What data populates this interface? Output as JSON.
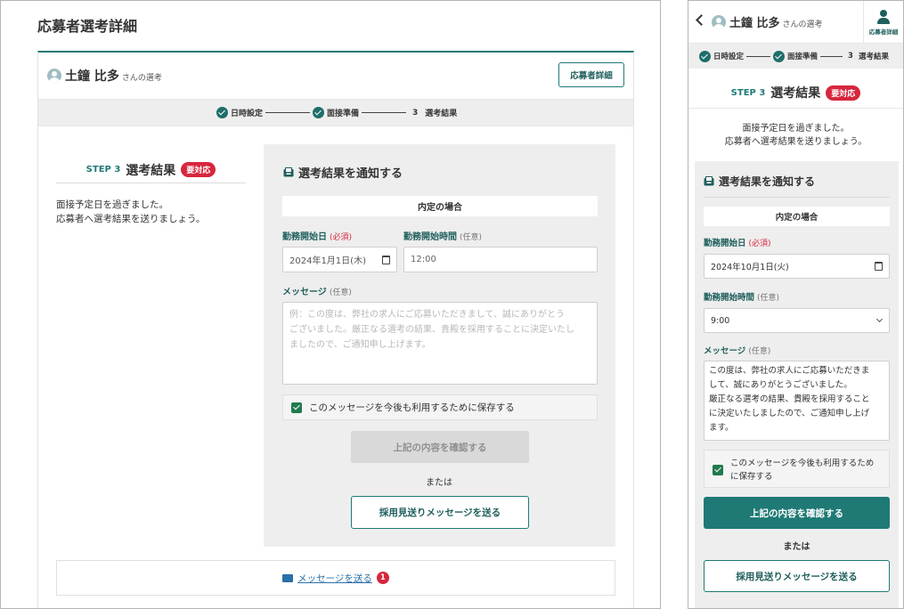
{
  "page_title": "応募者選考詳細",
  "applicant": {
    "name": "土鐘 比多",
    "suffix": "さんの選考"
  },
  "detail_button": "応募者詳細",
  "steps": [
    {
      "label": "日時設定",
      "state": "done"
    },
    {
      "label": "面接準備",
      "state": "done"
    },
    {
      "num": "3",
      "label": "選考結果",
      "state": "current"
    }
  ],
  "step_heading": {
    "step_label": "STEP 3",
    "title": "選考結果",
    "badge": "要対応"
  },
  "hint": {
    "line1": "面接予定日を過ぎました。",
    "line2": "応募者へ選考結果を送りましょう。"
  },
  "notify": {
    "title": "選考結果を通知する",
    "subhead": "内定の場合",
    "start_date_label": "勤務開始日",
    "required": "(必須)",
    "start_time_label": "勤務開始時間",
    "optional": "(任意)",
    "message_label": "メッセージ",
    "save_label": "このメッセージを今後も利用するために保存する",
    "confirm_button": "上記の内容を確認する",
    "or": "または",
    "reject_button": "採用見送りメッセージを送る"
  },
  "desktop_form": {
    "start_date": "2024年1月1日(木)",
    "start_time": "12:00",
    "message_placeholder_lines": [
      "例：この度は、弊社の求人にご応募いただきまして、誠にありがとう",
      "ございました。厳正なる選考の結果、貴殿を採用することに決定いたし",
      "ましたので、ご通知申し上げます。"
    ]
  },
  "mobile_form": {
    "start_date": "2024年10月1日(火)",
    "start_time": "9:00",
    "message_lines": [
      "この度は、弊社の求人にご応募いただきま",
      "して、誠にありがとうございました。",
      "厳正なる選考の結果、貴殿を採用すること",
      "に決定いたしましたので、ご通知申し上げ",
      "ます。"
    ],
    "save_lines": [
      "このメッセージを今後も利用するため",
      "に保存する"
    ]
  },
  "message_link": {
    "label": "メッセージを送る",
    "count": "1"
  },
  "colors": {
    "accent": "#1f7a76",
    "danger": "#d7263d",
    "link": "#2b6fa8"
  }
}
